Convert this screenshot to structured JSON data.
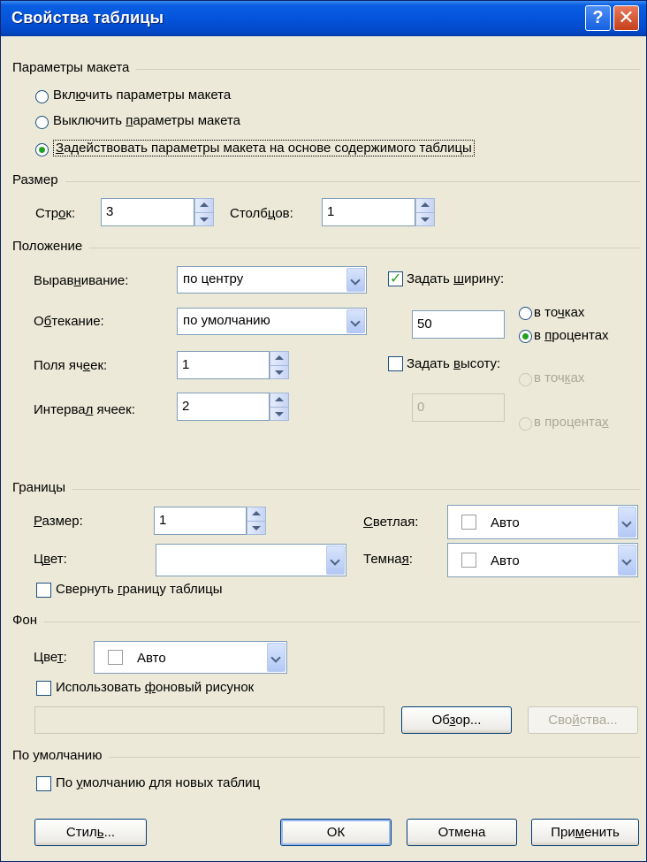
{
  "window": {
    "title": "Свойства таблицы",
    "help_glyph": "?",
    "close_glyph": "✕"
  },
  "layout_params": {
    "section": "Параметры макета",
    "options": [
      {
        "pre": "Вкл",
        "u": "ю",
        "post": "чить параметры макета",
        "selected": false
      },
      {
        "pre": "Выключить ",
        "u": "п",
        "post": "араметры макета",
        "selected": false
      },
      {
        "pre": "",
        "u": "З",
        "post": "адействовать параметры макета на основе содержимого таблицы",
        "selected": true
      }
    ]
  },
  "size": {
    "section": "Размер",
    "rows_label": {
      "pre": "Стр",
      "u": "о",
      "post": "к:"
    },
    "rows_value": "3",
    "cols_label": {
      "pre": "Столб",
      "u": "ц",
      "post": "ов:"
    },
    "cols_value": "1"
  },
  "position": {
    "section": "Положение",
    "align_label": {
      "pre": "Вырав",
      "u": "н",
      "post": "ивание:"
    },
    "align_value": "по центру",
    "wrap_label": {
      "pre": "О",
      "u": "б",
      "post": "текание:"
    },
    "wrap_value": "по умолчанию",
    "padding_label": {
      "pre": "Поля яч",
      "u": "е",
      "post": "ек:"
    },
    "padding_value": "1",
    "spacing_label": {
      "pre": "Интерва",
      "u": "л",
      "post": " ячеек:"
    },
    "spacing_value": "2",
    "set_width": {
      "pre": "Задать ",
      "u": "ш",
      "post": "ирину:",
      "checked": true
    },
    "width_value": "50",
    "width_points": {
      "pre": "в то",
      "u": "ч",
      "post": "ках",
      "selected": false
    },
    "width_percent": {
      "pre": "в ",
      "u": "п",
      "post": "роцентах",
      "selected": true
    },
    "set_height": {
      "pre": "Задать ",
      "u": "в",
      "post": "ысоту:",
      "checked": false
    },
    "height_value": "0",
    "height_points": {
      "pre": "в точ",
      "u": "к",
      "post": "ах"
    },
    "height_percent": {
      "pre": "в процента",
      "u": "х",
      "post": ""
    }
  },
  "borders": {
    "section": "Границы",
    "size_label": {
      "pre": "",
      "u": "Р",
      "post": "азмер:"
    },
    "size_value": "1",
    "color_label": {
      "pre": "Ц",
      "u": "в",
      "post": "ет:"
    },
    "color_value": "",
    "light_label": {
      "pre": "",
      "u": "С",
      "post": "ветлая:"
    },
    "light_value": "Авто",
    "dark_label": {
      "pre": "Темна",
      "u": "я",
      "post": ":"
    },
    "dark_value": "Авто",
    "collapse": {
      "pre": "Свернуть ",
      "u": "г",
      "post": "раницу таблицы",
      "checked": false
    }
  },
  "background": {
    "section": "Фон",
    "color_label": {
      "pre": "Цве",
      "u": "т",
      "post": ":"
    },
    "color_value": "Авто",
    "use_image": {
      "pre": "Использовать ",
      "u": "ф",
      "post": "оновый рисунок",
      "checked": false
    },
    "path_value": "",
    "browse_button": {
      "pre": "Об",
      "u": "з",
      "post": "ор..."
    },
    "properties_button": {
      "pre": "Сво",
      "u": "й",
      "post": "ства..."
    }
  },
  "defaults": {
    "section": "По умолчанию",
    "default_new": {
      "pre": "По ",
      "u": "у",
      "post": "молчанию для новых таблиц",
      "checked": false
    }
  },
  "buttons": {
    "style": {
      "pre": "Стил",
      "u": "ь",
      "post": "..."
    },
    "ok": "ОК",
    "cancel": "Отмена",
    "apply": {
      "pre": "При",
      "u": "м",
      "post": "енить"
    }
  }
}
